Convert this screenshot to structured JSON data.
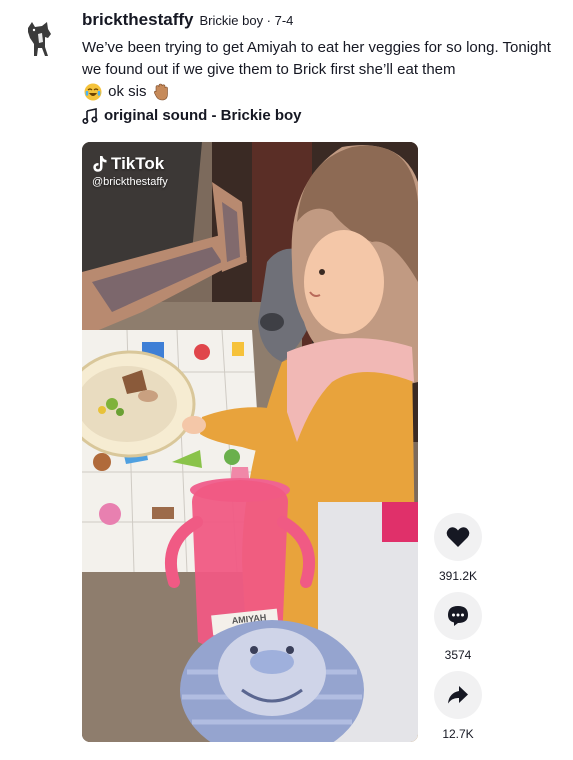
{
  "post": {
    "username": "brickthestaffy",
    "nickname": "Brickie boy",
    "date_sep": " · ",
    "date": "7-4",
    "caption_text": "We’ve been trying to get Amiyah to eat her veggies for so long. Tonight we found out if we give them to Brick first she’ll eat them",
    "caption_tail": "ok sis",
    "emojis": [
      "crying-laughing-emoji",
      "raised-hand-emoji"
    ]
  },
  "music": {
    "icon": "music-note-icon",
    "label": "original sound - Brickie boy"
  },
  "video": {
    "watermark_brand": "TikTok",
    "watermark_handle": "@brickthestaffy",
    "cup_label": "AMIYAH"
  },
  "actions": {
    "like": {
      "icon": "heart-icon",
      "count": "391.2K"
    },
    "comment": {
      "icon": "comment-icon",
      "count": "3574"
    },
    "share": {
      "icon": "share-icon",
      "count": "12.7K"
    }
  },
  "colors": {
    "text": "#161823",
    "action_bg": "#f1f1f2",
    "cup_pink": "#f0527a",
    "sweater": "#e8a33c"
  }
}
